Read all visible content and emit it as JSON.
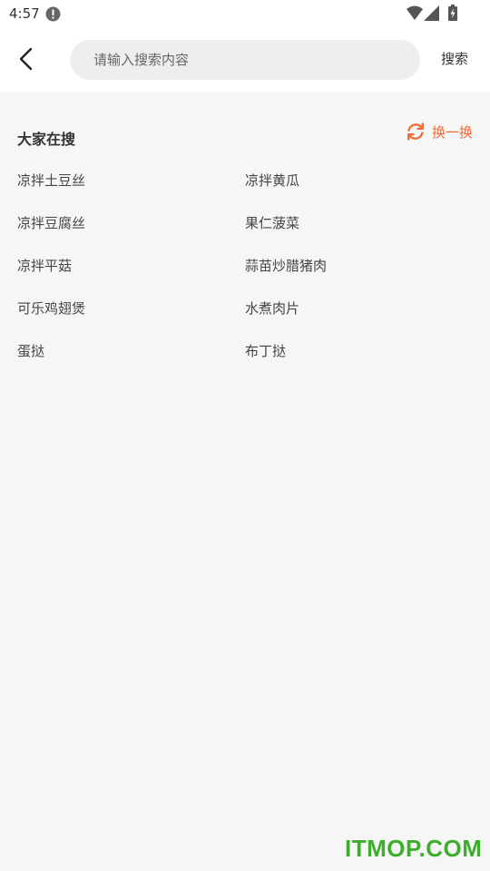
{
  "status_bar": {
    "time": "4:57"
  },
  "header": {
    "search_placeholder": "请输入搜索内容",
    "search_button_label": "搜索"
  },
  "hot_search": {
    "title": "大家在搜",
    "refresh_label": "换一换",
    "accent_color": "#f06b35",
    "items": [
      "凉拌土豆丝",
      "凉拌黄瓜",
      "凉拌豆腐丝",
      "果仁菠菜",
      "凉拌平菇",
      "蒜苗炒腊猪肉",
      "可乐鸡翅煲",
      "水煮肉片",
      "蛋挞",
      "布丁挞"
    ]
  },
  "watermark": {
    "text": "ITMOP.COM",
    "color": "#3dae2b"
  },
  "icons": {
    "status": [
      "alert-icon",
      "wifi-icon",
      "signal-icon",
      "battery-icon"
    ],
    "back": "chevron-left-icon",
    "refresh": "refresh-icon"
  }
}
